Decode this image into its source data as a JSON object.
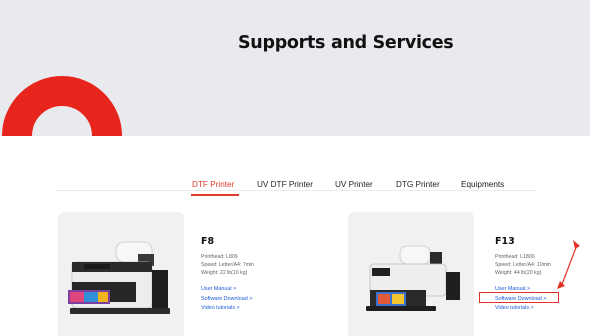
{
  "hero": {
    "title": "Supports and Services",
    "accent_color": "#e8251c",
    "background_color": "#e9eaee"
  },
  "tabs": [
    {
      "label": "DTF Printer",
      "active": true
    },
    {
      "label": "UV DTF Printer",
      "active": false
    },
    {
      "label": "UV Printer",
      "active": false
    },
    {
      "label": "DTG Printer",
      "active": false
    },
    {
      "label": "Equipments",
      "active": false
    }
  ],
  "products": [
    {
      "name": "F8",
      "specs": [
        "Printhead: L809",
        "Speed: Letter/A4: 7min",
        "Weight: 22 lb(10 kg)"
      ],
      "links": [
        "User Manual >",
        "Software Download >",
        "Video tutorials >"
      ]
    },
    {
      "name": "F13",
      "specs": [
        "Printhead: L1800",
        "Speed: Letter/A4: 10min",
        "Weight: 44 lb(20 kg)"
      ],
      "links": [
        "User Manual >",
        "Software Download >",
        "Video tutorials >"
      ]
    }
  ],
  "colors": {
    "active_tab": "#e03a2f",
    "link": "#1a5bd6",
    "annotation": "#e53027"
  }
}
